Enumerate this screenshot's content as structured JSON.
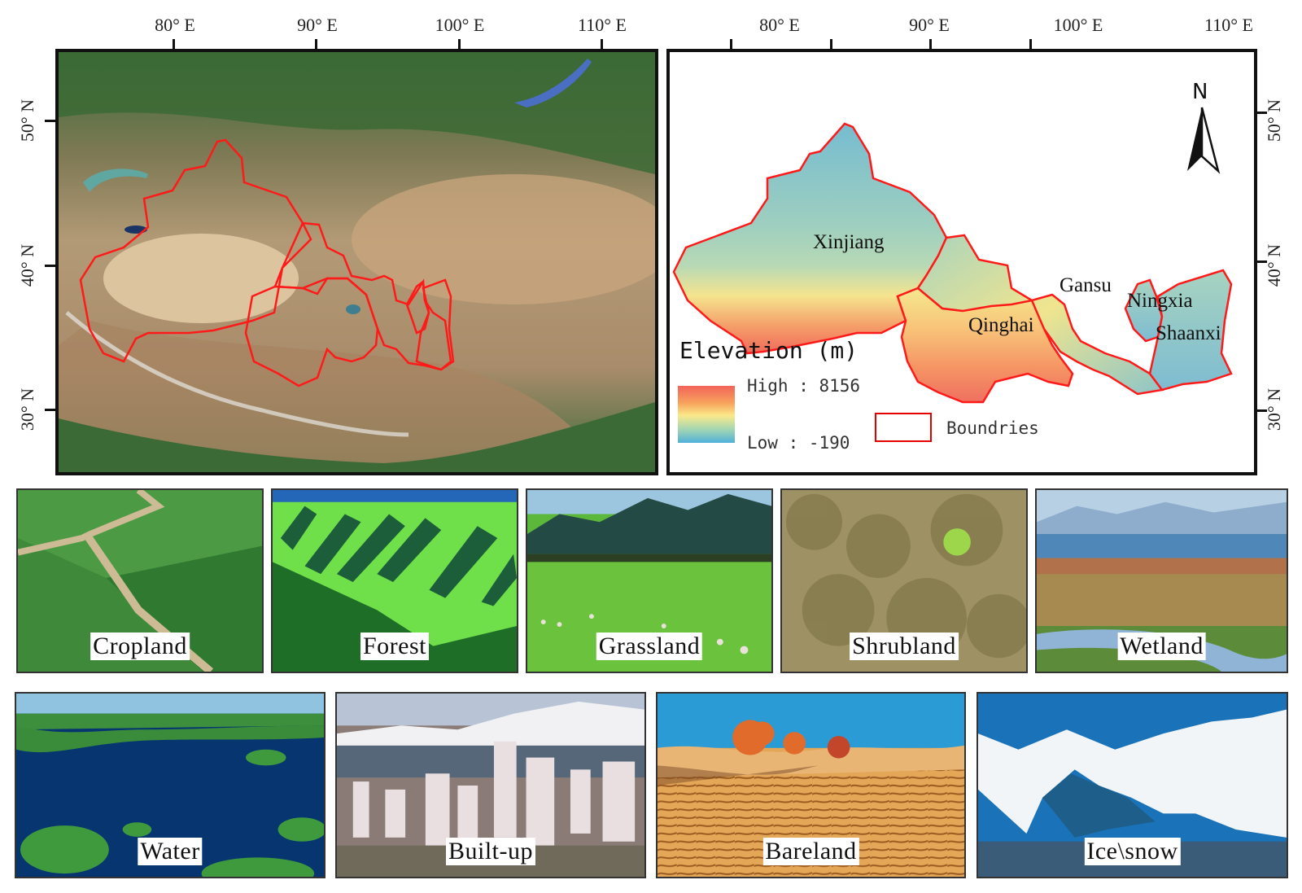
{
  "figure": {
    "lon_labels": [
      "80° E",
      "90° E",
      "100° E",
      "110° E"
    ],
    "lat_labels": [
      "50° N",
      "40° N",
      "30° N"
    ]
  },
  "left_map": {
    "type": "satellite-imagery",
    "boundary_color": "#ff1a1a"
  },
  "right_map": {
    "type": "elevation",
    "provinces": [
      "Xinjiang",
      "Gansu",
      "Qinghai",
      "Ningxia",
      "Shaanxi"
    ],
    "north_arrow": {
      "label": "N",
      "icon": "north-arrow-icon"
    },
    "legend": {
      "title": "Elevation (m)",
      "high_label": "High : 8156",
      "low_label": "Low : -190",
      "boundary_label": "Boundries",
      "high_value": 8156,
      "low_value": -190,
      "ramp_colors": [
        "#f2645a",
        "#f7a35c",
        "#fbe98a",
        "#a7d8b0",
        "#4fb0db"
      ],
      "boundary_color": "#e50000"
    }
  },
  "photos": [
    {
      "label": "Cropland",
      "theme": "cropland"
    },
    {
      "label": "Forest",
      "theme": "forest"
    },
    {
      "label": "Grassland",
      "theme": "grassland"
    },
    {
      "label": "Shrubland",
      "theme": "shrubland"
    },
    {
      "label": "Wetland",
      "theme": "wetland"
    },
    {
      "label": "Water",
      "theme": "water"
    },
    {
      "label": "Built-up",
      "theme": "builtup"
    },
    {
      "label": "Bareland",
      "theme": "bareland"
    },
    {
      "label": "Ice\\snow",
      "theme": "icesnow"
    }
  ]
}
